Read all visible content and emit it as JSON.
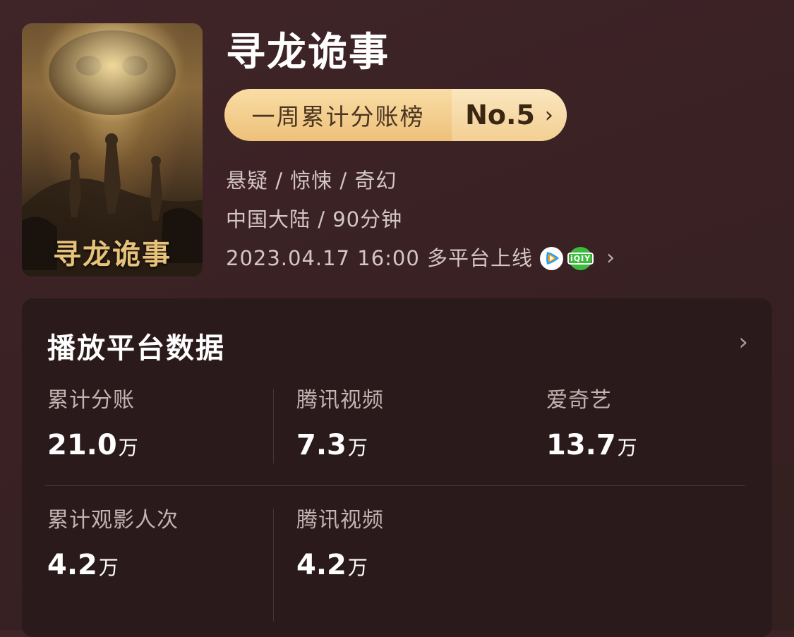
{
  "movie": {
    "title": "寻龙诡事",
    "poster_text": "寻龙诡事",
    "rank_label": "一周累计分账榜",
    "rank_value": "No.5",
    "rank_chevron": "›",
    "genre": "悬疑 / 惊悚 / 奇幻",
    "region_duration": "中国大陆 / 90分钟",
    "release": "2023.04.17 16:00 多平台上线",
    "release_chevron": "›",
    "platform_icons": [
      "tencent-video-icon",
      "iqiyi-icon"
    ],
    "iqiyi_logo_text": "iQIY"
  },
  "platform_data": {
    "title": "播放平台数据",
    "chevron": "›",
    "row1": {
      "total": {
        "label": "累计分账",
        "value": "21.0",
        "unit": "万"
      },
      "tencent": {
        "label": "腾讯视频",
        "value": "7.3",
        "unit": "万"
      },
      "iqiyi": {
        "label": "爱奇艺",
        "value": "13.7",
        "unit": "万"
      }
    },
    "row2": {
      "total": {
        "label": "累计观影人次",
        "value": "4.2",
        "unit": "万"
      },
      "tencent": {
        "label": "腾讯视频",
        "value": "4.2",
        "unit": "万"
      }
    }
  },
  "colors": {
    "background": "#3a2124",
    "card": "#2b1a1b",
    "rank_gold": "#eec07a"
  }
}
